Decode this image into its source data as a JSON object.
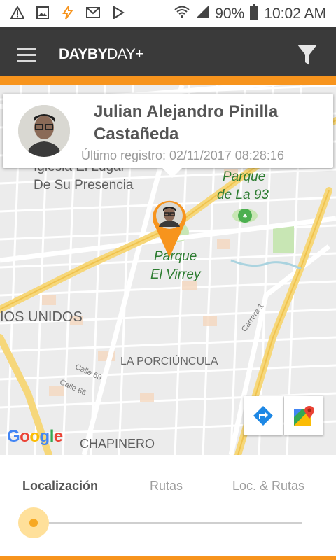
{
  "status_bar": {
    "battery": "90%",
    "time": "10:02 AM",
    "icons": [
      "warning-icon",
      "image-icon",
      "flash-icon",
      "gmail-icon",
      "play-store-icon",
      "wifi-icon",
      "signal-icon",
      "battery-icon"
    ]
  },
  "app_bar": {
    "logo_part1": "DAYBY",
    "logo_part2": "DAY+",
    "menu_icon": "hamburger-menu-icon",
    "filter_icon": "filter-icon",
    "bar_color": "#3a3a3a",
    "accent_color": "#f7941d"
  },
  "info_card": {
    "name": "Julian Alejandro Pinilla Castañeda",
    "last_record": "Último registro: 02/11/2017 08:28:16"
  },
  "map": {
    "labels": {
      "church_line1": "Iglesia El Lugar",
      "church_line2": "De Su Presencia",
      "park93_line1": "Parque",
      "park93_line2": "de La 93",
      "virrey_line1": "Parque",
      "virrey_line2": "El Virrey",
      "unidos": "IOS UNIDOS",
      "porciuncula": "LA PORCIÚNCULA",
      "chapinero": "CHAPINERO",
      "calle68": "Calle 68",
      "calle66": "Calle 66",
      "carrera1": "Carrera 1"
    },
    "google_logo": "Google",
    "controls": [
      "directions-icon",
      "google-maps-icon"
    ]
  },
  "tabs": [
    {
      "label": "Localización",
      "active": true
    },
    {
      "label": "Rutas",
      "active": false
    },
    {
      "label": "Loc. & Rutas",
      "active": false
    }
  ],
  "slider": {
    "value": 0
  }
}
